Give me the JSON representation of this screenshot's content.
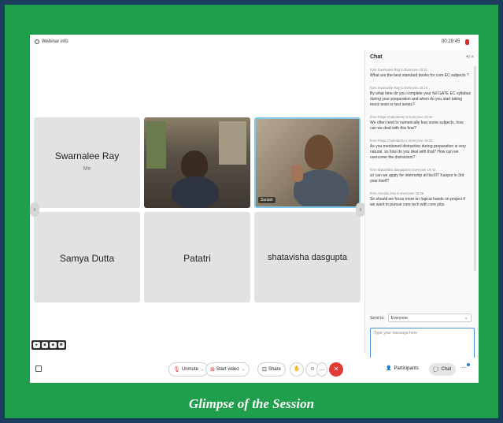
{
  "caption": "Glimpse of the Session",
  "topbar": {
    "webinar_info": "Webinar info",
    "timer": "00:29:45"
  },
  "tiles": [
    {
      "name": "Swarnalee Ray",
      "sub": "Me"
    },
    {
      "name": "",
      "video": true
    },
    {
      "name": "",
      "video": true,
      "tag": "Sunset"
    },
    {
      "name": "Samya Dutta"
    },
    {
      "name": "Patatri"
    },
    {
      "name": "shatavisha dasgupta"
    }
  ],
  "chat": {
    "title": "Chat",
    "messages": [
      {
        "meta": "from Swarnalee Ray to Everyone  19:11",
        "text": "What are the best standard books for core EC subjects ?"
      },
      {
        "meta": "from Swarnalee Ray to Everyone  19:16",
        "text": "By what time do you complete your full GATE EC syllabus during your preparation and when do you start taking mock tests or test series?"
      },
      {
        "meta": "from Ritaja Chakraborty to Everyone  19:32",
        "text": "We often tend to numerically fear some subjects, how can we deal with this fear?"
      },
      {
        "meta": "from Ritaja Chakraborty to Everyone  19:33",
        "text": "As you mentioned distraction during preparation is very natural, so how do you deal with that? How can we overcome the distraction?"
      },
      {
        "meta": "from shatavisha dasgupta to Everyone  19:44",
        "text": "sir can we apply for internship at IIsc/IIT Kanpur in 3rd year itself?"
      },
      {
        "meta": "from Anindita Dey to Everyone  19:46",
        "text": "Sir should we focus more on logical hands on project if we want to pursue core tech with core jobs"
      }
    ],
    "send_to_label": "Send to:",
    "send_to_value": "Everyone",
    "input_placeholder": "Type your message here"
  },
  "bottombar": {
    "unmute": "Unmute",
    "start_video": "Start video",
    "share": "Share",
    "participants": "Participants",
    "chat": "Chat"
  },
  "colors": {
    "frame": "#1f9e4b",
    "border": "#1b3d5e",
    "end": "#e23b35"
  }
}
